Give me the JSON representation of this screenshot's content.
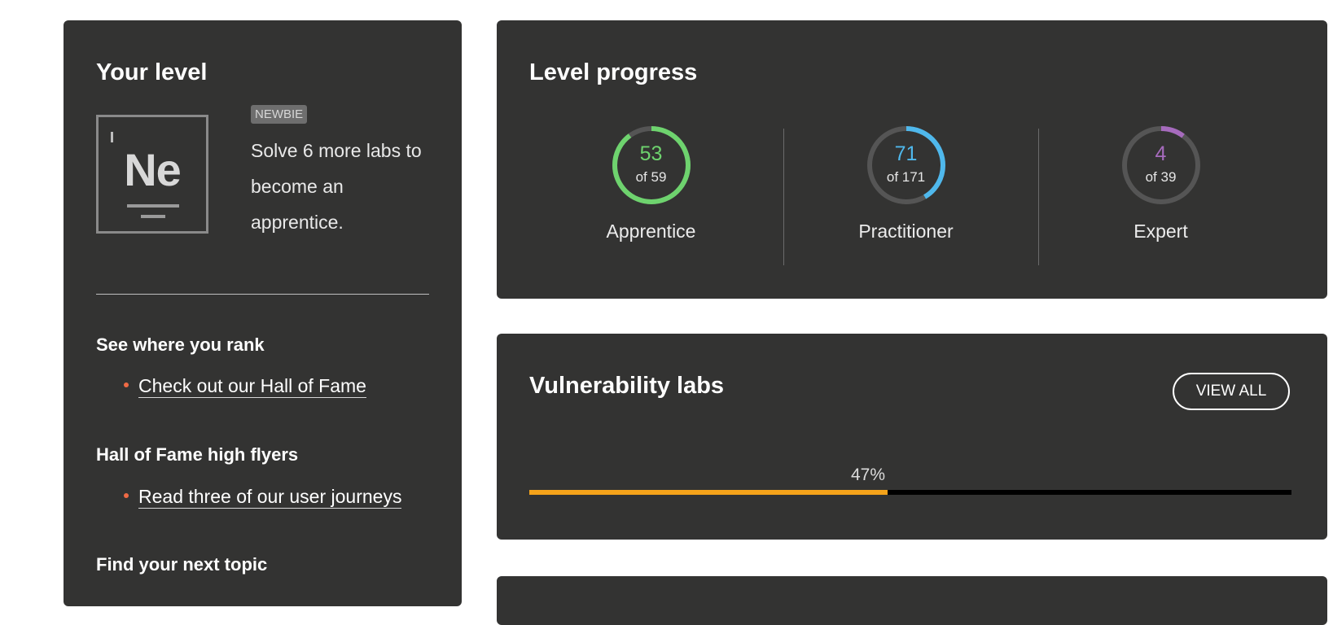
{
  "your_level": {
    "title": "Your level",
    "element_symbol": "Ne",
    "badge": "NEWBIE",
    "message": "Solve 6 more labs to become an apprentice."
  },
  "sections": {
    "rank": {
      "heading": "See where you rank",
      "link": "Check out our Hall of Fame"
    },
    "flyers": {
      "heading": "Hall of Fame high flyers",
      "link": "Read three of our user journeys"
    },
    "topic": {
      "heading": "Find your next topic"
    },
    "bullet_color": "#f06a45"
  },
  "level_progress": {
    "title": "Level progress",
    "levels": [
      {
        "label": "Apprentice",
        "count": "53",
        "of_text": "of 59",
        "solved": 53,
        "total": 59,
        "color": "#6ed36e"
      },
      {
        "label": "Practitioner",
        "count": "71",
        "of_text": "of 171",
        "solved": 71,
        "total": 171,
        "color": "#4fb8ec"
      },
      {
        "label": "Expert",
        "count": "4",
        "of_text": "of 39",
        "solved": 4,
        "total": 39,
        "color": "#a66bbd"
      }
    ],
    "track_color": "#555555"
  },
  "vulnerability_labs": {
    "title": "Vulnerability labs",
    "view_all_label": "VIEW ALL",
    "percent_text": "47%",
    "progress_fraction": 0.47,
    "bar_color": "#f5a31a"
  }
}
